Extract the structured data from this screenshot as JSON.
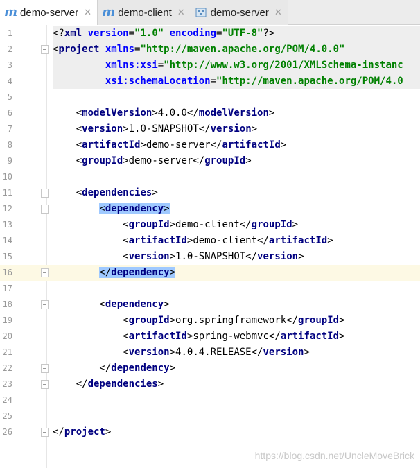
{
  "tabs": [
    {
      "label": "demo-server",
      "icon": "maven-m-icon",
      "active": true
    },
    {
      "label": "demo-client",
      "icon": "maven-m-icon",
      "active": false
    },
    {
      "label": "demo-server",
      "icon": "structure-icon",
      "active": false
    }
  ],
  "watermark": "https://blog.csdn.net/UncleMoveBrick",
  "lines": [
    {
      "n": "1",
      "parts": [
        [
          "t-b",
          "<?"
        ],
        [
          "t-tag",
          "xml "
        ],
        [
          "t-attr",
          "version"
        ],
        [
          "t-b",
          "="
        ],
        [
          "t-str",
          "\"1.0\" "
        ],
        [
          "t-attr",
          "encoding"
        ],
        [
          "t-b",
          "="
        ],
        [
          "t-str",
          "\"UTF-8\""
        ],
        [
          "t-b",
          "?>"
        ]
      ]
    },
    {
      "n": "2",
      "parts": [
        [
          "t-b",
          "<"
        ],
        [
          "t-tag",
          "project "
        ],
        [
          "t-attr",
          "xmlns"
        ],
        [
          "t-b",
          "="
        ],
        [
          "t-str",
          "\"http://maven.apache.org/POM/4.0.0\""
        ]
      ]
    },
    {
      "n": "3",
      "parts": [
        [
          "t-b",
          "         "
        ],
        [
          "t-attr",
          "xmlns:xsi"
        ],
        [
          "t-b",
          "="
        ],
        [
          "t-str",
          "\"http://www.w3.org/2001/XMLSchema-instanc"
        ]
      ]
    },
    {
      "n": "4",
      "parts": [
        [
          "t-b",
          "         "
        ],
        [
          "t-attr",
          "xsi:schemaLocation"
        ],
        [
          "t-b",
          "="
        ],
        [
          "t-str",
          "\"http://maven.apache.org/POM/4.0"
        ]
      ]
    },
    {
      "n": "5",
      "parts": []
    },
    {
      "n": "6",
      "parts": [
        [
          "t-b",
          "    <"
        ],
        [
          "t-tag",
          "modelVersion"
        ],
        [
          "t-b",
          ">"
        ],
        [
          "t-txt",
          "4.0.0"
        ],
        [
          "t-b",
          "</"
        ],
        [
          "t-tag",
          "modelVersion"
        ],
        [
          "t-b",
          ">"
        ]
      ]
    },
    {
      "n": "7",
      "parts": [
        [
          "t-b",
          "    <"
        ],
        [
          "t-tag",
          "version"
        ],
        [
          "t-b",
          ">"
        ],
        [
          "t-txt",
          "1.0-SNAPSHOT"
        ],
        [
          "t-b",
          "</"
        ],
        [
          "t-tag",
          "version"
        ],
        [
          "t-b",
          ">"
        ]
      ]
    },
    {
      "n": "8",
      "parts": [
        [
          "t-b",
          "    <"
        ],
        [
          "t-tag",
          "artifactId"
        ],
        [
          "t-b",
          ">"
        ],
        [
          "t-txt",
          "demo-server"
        ],
        [
          "t-b",
          "</"
        ],
        [
          "t-tag",
          "artifactId"
        ],
        [
          "t-b",
          ">"
        ]
      ]
    },
    {
      "n": "9",
      "parts": [
        [
          "t-b",
          "    <"
        ],
        [
          "t-tag",
          "groupId"
        ],
        [
          "t-b",
          ">"
        ],
        [
          "t-txt",
          "demo-server"
        ],
        [
          "t-b",
          "</"
        ],
        [
          "t-tag",
          "groupId"
        ],
        [
          "t-b",
          ">"
        ]
      ]
    },
    {
      "n": "10",
      "parts": []
    },
    {
      "n": "11",
      "parts": [
        [
          "t-b",
          "    <"
        ],
        [
          "t-tag",
          "dependencies"
        ],
        [
          "t-b",
          ">"
        ]
      ]
    },
    {
      "n": "12",
      "parts": [
        [
          "t-b",
          "        "
        ],
        [
          "sel-open",
          "<"
        ],
        [
          "sel-tag",
          "dependency"
        ],
        [
          "sel-open",
          ">"
        ]
      ]
    },
    {
      "n": "13",
      "parts": [
        [
          "t-b",
          "            <"
        ],
        [
          "t-tag",
          "groupId"
        ],
        [
          "t-b",
          ">"
        ],
        [
          "t-txt",
          "demo-client"
        ],
        [
          "t-b",
          "</"
        ],
        [
          "t-tag",
          "groupId"
        ],
        [
          "t-b",
          ">"
        ]
      ]
    },
    {
      "n": "14",
      "parts": [
        [
          "t-b",
          "            <"
        ],
        [
          "t-tag",
          "artifactId"
        ],
        [
          "t-b",
          ">"
        ],
        [
          "t-txt",
          "demo-client"
        ],
        [
          "t-b",
          "</"
        ],
        [
          "t-tag",
          "artifactId"
        ],
        [
          "t-b",
          ">"
        ]
      ]
    },
    {
      "n": "15",
      "parts": [
        [
          "t-b",
          "            <"
        ],
        [
          "t-tag",
          "version"
        ],
        [
          "t-b",
          ">"
        ],
        [
          "t-txt",
          "1.0-SNAPSHOT"
        ],
        [
          "t-b",
          "</"
        ],
        [
          "t-tag",
          "version"
        ],
        [
          "t-b",
          ">"
        ]
      ]
    },
    {
      "n": "16",
      "parts": [
        [
          "t-b",
          "        "
        ],
        [
          "sel-open",
          "</"
        ],
        [
          "sel-tag",
          "dependency"
        ],
        [
          "sel-open",
          ">"
        ]
      ]
    },
    {
      "n": "17",
      "parts": []
    },
    {
      "n": "18",
      "parts": [
        [
          "t-b",
          "        <"
        ],
        [
          "t-tag",
          "dependency"
        ],
        [
          "t-b",
          ">"
        ]
      ]
    },
    {
      "n": "19",
      "parts": [
        [
          "t-b",
          "            <"
        ],
        [
          "t-tag",
          "groupId"
        ],
        [
          "t-b",
          ">"
        ],
        [
          "t-txt",
          "org.springframework"
        ],
        [
          "t-b",
          "</"
        ],
        [
          "t-tag",
          "groupId"
        ],
        [
          "t-b",
          ">"
        ]
      ]
    },
    {
      "n": "20",
      "parts": [
        [
          "t-b",
          "            <"
        ],
        [
          "t-tag",
          "artifactId"
        ],
        [
          "t-b",
          ">"
        ],
        [
          "t-txt",
          "spring-webmvc"
        ],
        [
          "t-b",
          "</"
        ],
        [
          "t-tag",
          "artifactId"
        ],
        [
          "t-b",
          ">"
        ]
      ]
    },
    {
      "n": "21",
      "parts": [
        [
          "t-b",
          "            <"
        ],
        [
          "t-tag",
          "version"
        ],
        [
          "t-b",
          ">"
        ],
        [
          "t-txt",
          "4.0.4.RELEASE"
        ],
        [
          "t-b",
          "</"
        ],
        [
          "t-tag",
          "version"
        ],
        [
          "t-b",
          ">"
        ]
      ]
    },
    {
      "n": "22",
      "parts": [
        [
          "t-b",
          "        </"
        ],
        [
          "t-tag",
          "dependency"
        ],
        [
          "t-b",
          ">"
        ]
      ]
    },
    {
      "n": "23",
      "parts": [
        [
          "t-b",
          "    </"
        ],
        [
          "t-tag",
          "dependencies"
        ],
        [
          "t-b",
          ">"
        ]
      ]
    },
    {
      "n": "24",
      "parts": []
    },
    {
      "n": "25",
      "parts": []
    },
    {
      "n": "26",
      "parts": [
        [
          "t-b",
          "</"
        ],
        [
          "t-tag",
          "project"
        ],
        [
          "t-b",
          ">"
        ]
      ]
    }
  ]
}
